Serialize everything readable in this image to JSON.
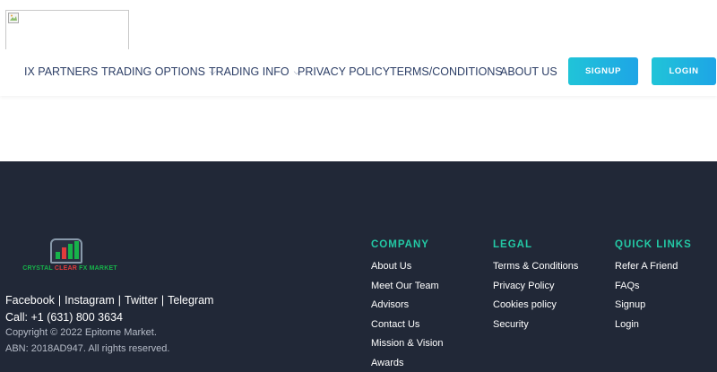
{
  "header": {
    "nav": [
      {
        "label": "IX PARTNERS",
        "has_dropdown": false
      },
      {
        "label": "TRADING OPTIONS",
        "has_dropdown": true
      },
      {
        "label": "TRADING INFO",
        "has_dropdown": true
      },
      {
        "label": "PRIVACY POLICY",
        "has_dropdown": false
      },
      {
        "label": "TERMS/CONDITIONS",
        "has_dropdown": false
      },
      {
        "label": "ABOUT US",
        "has_dropdown": false
      }
    ],
    "dropdown_glyph": "⌵",
    "signup_label": "SIGNUP",
    "login_label": "LOGIN",
    "button_color": "#1ea5e6"
  },
  "footer": {
    "background": "#212837",
    "accent": "#23c9a5",
    "brand": {
      "text_green_a": "CRYSTAL ",
      "text_red": "CLEAR",
      "text_green_b": " FX MARKET"
    },
    "social": [
      "Facebook",
      "Instagram",
      "Twitter",
      "Telegram"
    ],
    "social_separator": "|",
    "call": "Call: +1 (631) 800 3634",
    "copyright": "Copyright © 2022 Epitome Market.",
    "abn": "ABN: 2018AD947. All rights reserved.",
    "columns": [
      {
        "title": "COMPANY",
        "links": [
          "About Us",
          "Meet Our Team",
          "Advisors",
          "Contact Us",
          "Mission & Vision",
          "Awards"
        ]
      },
      {
        "title": "LEGAL",
        "links": [
          "Terms & Conditions",
          "Privacy Policy",
          "Cookies policy",
          "Security"
        ]
      },
      {
        "title": "QUICK LINKS",
        "links": [
          "Refer A Friend",
          "FAQs",
          "Signup",
          "Login"
        ]
      }
    ]
  }
}
